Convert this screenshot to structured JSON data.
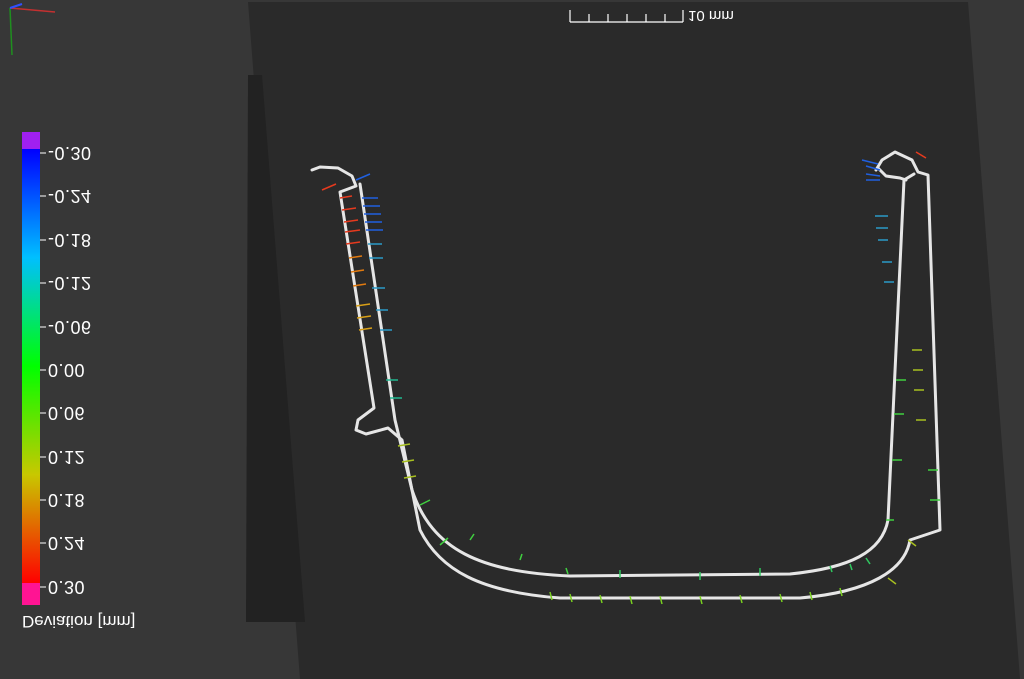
{
  "legend": {
    "caption": "Deviation [mm]",
    "ticks": [
      "-0.30",
      "-0.24",
      "-0.18",
      "-0.12",
      "-0.06",
      "0.00",
      "0.06",
      "0.12",
      "0.18",
      "0.24",
      "0.30"
    ],
    "range": [
      -0.3,
      0.3
    ],
    "colors": {
      "below_min": "#a020f0",
      "min": "#0000ff",
      "mid": "#00ff00",
      "max": "#ff0000",
      "above_max": "#ff1493"
    }
  },
  "scale_bar": {
    "label": "10 mm"
  },
  "axis_triad": {
    "x_color": "#ff0000",
    "y_color": "#00cc00",
    "z_color": "#3050ff"
  },
  "colors": {
    "background": "#373737",
    "scan_plane": "#2a2a2a",
    "profile": "#e6e6e6"
  }
}
